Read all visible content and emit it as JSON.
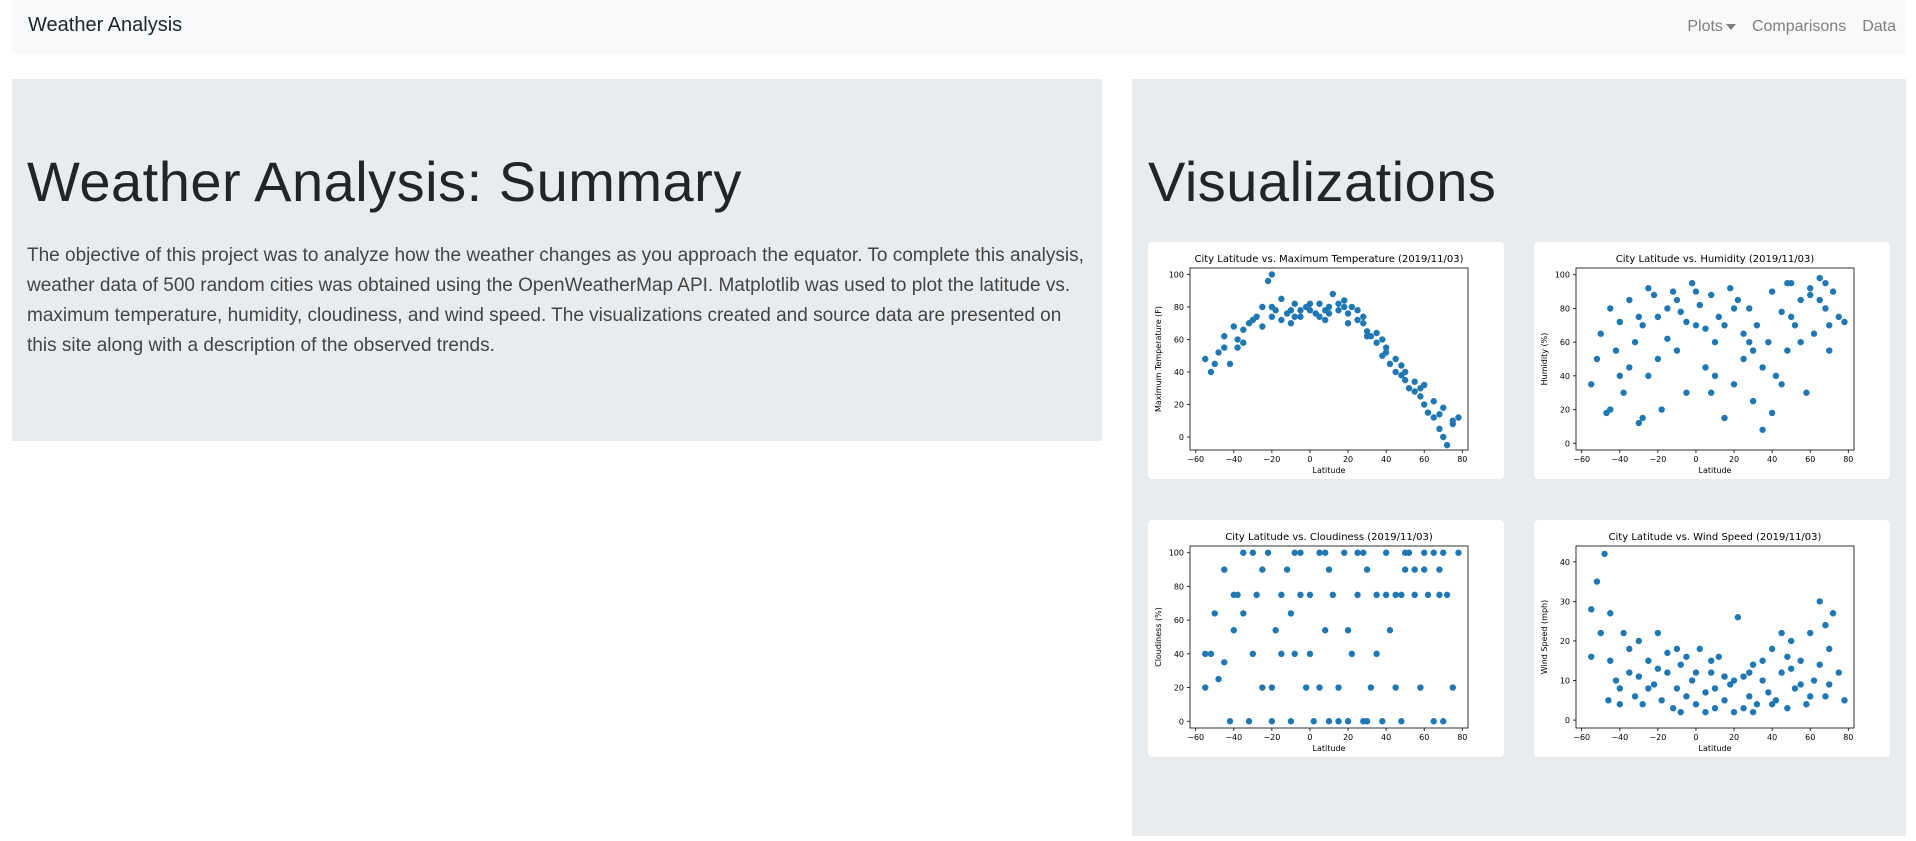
{
  "navbar": {
    "brand": "Weather Analysis",
    "links": [
      {
        "label": "Plots",
        "dropdown": true
      },
      {
        "label": "Comparisons"
      },
      {
        "label": "Data"
      }
    ]
  },
  "summary": {
    "title": "Weather Analysis: Summary",
    "body": "The objective of this project was to analyze how the weather changes as you approach the equator. To complete this analysis, weather data of 500 random cities was obtained using the OpenWeatherMap API. Matplotlib was used to plot the latitude vs. maximum temperature, humidity, cloudiness, and wind speed. The visualizations created and source data are presented on this site along with a description of the observed trends."
  },
  "visualizations": {
    "title": "Visualizations"
  },
  "colors": {
    "point": "#1f77b4"
  },
  "chart_data": [
    {
      "type": "scatter",
      "title": "City Latitude vs. Maximum Temperature (2019/11/03)",
      "xlabel": "Latitude",
      "ylabel": "Maximum Temperature (F)",
      "xlim": [
        -63,
        83
      ],
      "ylim": [
        -8,
        104
      ],
      "xticks": [
        -60,
        -40,
        -20,
        0,
        20,
        40,
        60,
        80
      ],
      "yticks": [
        0,
        20,
        40,
        60,
        80,
        100
      ],
      "points": [
        [
          -55,
          48
        ],
        [
          -52,
          40
        ],
        [
          -48,
          52
        ],
        [
          -45,
          55
        ],
        [
          -42,
          45
        ],
        [
          -38,
          60
        ],
        [
          -35,
          66
        ],
        [
          -32,
          70
        ],
        [
          -28,
          74
        ],
        [
          -25,
          80
        ],
        [
          -22,
          96
        ],
        [
          -20,
          100
        ],
        [
          -18,
          78
        ],
        [
          -15,
          85
        ],
        [
          -12,
          76
        ],
        [
          -10,
          70
        ],
        [
          -8,
          82
        ],
        [
          -5,
          74
        ],
        [
          -2,
          80
        ],
        [
          0,
          78
        ],
        [
          3,
          76
        ],
        [
          5,
          82
        ],
        [
          8,
          72
        ],
        [
          10,
          80
        ],
        [
          12,
          88
        ],
        [
          15,
          78
        ],
        [
          18,
          84
        ],
        [
          20,
          76
        ],
        [
          22,
          80
        ],
        [
          25,
          72
        ],
        [
          28,
          70
        ],
        [
          30,
          65
        ],
        [
          32,
          62
        ],
        [
          35,
          58
        ],
        [
          38,
          50
        ],
        [
          40,
          55
        ],
        [
          42,
          45
        ],
        [
          45,
          40
        ],
        [
          48,
          38
        ],
        [
          50,
          35
        ],
        [
          52,
          30
        ],
        [
          55,
          28
        ],
        [
          58,
          25
        ],
        [
          60,
          20
        ],
        [
          62,
          15
        ],
        [
          65,
          12
        ],
        [
          68,
          5
        ],
        [
          70,
          0
        ],
        [
          72,
          -5
        ],
        [
          75,
          10
        ],
        [
          -45,
          62
        ],
        [
          -40,
          68
        ],
        [
          -30,
          72
        ],
        [
          -20,
          74
        ],
        [
          -10,
          78
        ],
        [
          0,
          82
        ],
        [
          10,
          76
        ],
        [
          20,
          70
        ],
        [
          30,
          62
        ],
        [
          40,
          52
        ],
        [
          50,
          40
        ],
        [
          60,
          32
        ],
        [
          70,
          18
        ],
        [
          -38,
          55
        ],
        [
          -25,
          68
        ],
        [
          -15,
          72
        ],
        [
          -5,
          78
        ],
        [
          5,
          74
        ],
        [
          15,
          82
        ],
        [
          25,
          78
        ],
        [
          35,
          64
        ],
        [
          45,
          48
        ],
        [
          55,
          34
        ],
        [
          65,
          22
        ],
        [
          75,
          8
        ],
        [
          -50,
          45
        ],
        [
          -35,
          58
        ],
        [
          -20,
          80
        ],
        [
          -8,
          74
        ],
        [
          8,
          78
        ],
        [
          18,
          80
        ],
        [
          28,
          74
        ],
        [
          38,
          60
        ],
        [
          48,
          44
        ],
        [
          58,
          30
        ],
        [
          68,
          14
        ],
        [
          78,
          12
        ]
      ]
    },
    {
      "type": "scatter",
      "title": "City Latitude vs. Humidity (2019/11/03)",
      "xlabel": "Latitude",
      "ylabel": "Humidity (%)",
      "xlim": [
        -63,
        83
      ],
      "ylim": [
        -4,
        104
      ],
      "xticks": [
        -60,
        -40,
        -20,
        0,
        20,
        40,
        60,
        80
      ],
      "yticks": [
        0,
        20,
        40,
        60,
        80,
        100
      ],
      "points": [
        [
          -55,
          35
        ],
        [
          -50,
          65
        ],
        [
          -47,
          18
        ],
        [
          -45,
          80
        ],
        [
          -42,
          55
        ],
        [
          -40,
          72
        ],
        [
          -38,
          30
        ],
        [
          -35,
          85
        ],
        [
          -32,
          60
        ],
        [
          -30,
          12
        ],
        [
          -28,
          70
        ],
        [
          -25,
          40
        ],
        [
          -22,
          88
        ],
        [
          -20,
          75
        ],
        [
          -18,
          20
        ],
        [
          -15,
          62
        ],
        [
          -12,
          90
        ],
        [
          -10,
          55
        ],
        [
          -8,
          78
        ],
        [
          -5,
          30
        ],
        [
          -2,
          95
        ],
        [
          0,
          70
        ],
        [
          2,
          82
        ],
        [
          5,
          45
        ],
        [
          8,
          88
        ],
        [
          10,
          60
        ],
        [
          12,
          75
        ],
        [
          15,
          15
        ],
        [
          18,
          92
        ],
        [
          20,
          35
        ],
        [
          22,
          85
        ],
        [
          25,
          50
        ],
        [
          28,
          80
        ],
        [
          30,
          25
        ],
        [
          32,
          70
        ],
        [
          35,
          8
        ],
        [
          38,
          60
        ],
        [
          40,
          90
        ],
        [
          42,
          40
        ],
        [
          45,
          78
        ],
        [
          48,
          55
        ],
        [
          50,
          95
        ],
        [
          52,
          70
        ],
        [
          55,
          85
        ],
        [
          58,
          30
        ],
        [
          60,
          92
        ],
        [
          62,
          65
        ],
        [
          65,
          98
        ],
        [
          68,
          80
        ],
        [
          70,
          55
        ],
        [
          72,
          90
        ],
        [
          75,
          75
        ],
        [
          78,
          72
        ],
        [
          -45,
          20
        ],
        [
          -35,
          45
        ],
        [
          -25,
          92
        ],
        [
          -15,
          80
        ],
        [
          -5,
          72
        ],
        [
          5,
          68
        ],
        [
          15,
          70
        ],
        [
          25,
          65
        ],
        [
          35,
          45
        ],
        [
          45,
          35
        ],
        [
          55,
          60
        ],
        [
          65,
          85
        ],
        [
          -40,
          40
        ],
        [
          -30,
          75
        ],
        [
          -20,
          50
        ],
        [
          -10,
          85
        ],
        [
          0,
          90
        ],
        [
          10,
          40
        ],
        [
          20,
          80
        ],
        [
          30,
          55
        ],
        [
          40,
          18
        ],
        [
          50,
          75
        ],
        [
          60,
          88
        ],
        [
          70,
          70
        ],
        [
          -52,
          50
        ],
        [
          -28,
          15
        ],
        [
          8,
          30
        ],
        [
          28,
          60
        ],
        [
          48,
          95
        ],
        [
          68,
          95
        ]
      ]
    },
    {
      "type": "scatter",
      "title": "City Latitude vs. Cloudiness (2019/11/03)",
      "xlabel": "Latitude",
      "ylabel": "Cloudiness (%)",
      "xlim": [
        -63,
        83
      ],
      "ylim": [
        -4,
        104
      ],
      "xticks": [
        -60,
        -40,
        -20,
        0,
        20,
        40,
        60,
        80
      ],
      "yticks": [
        0,
        20,
        40,
        60,
        80,
        100
      ],
      "points": [
        [
          -55,
          20
        ],
        [
          -52,
          40
        ],
        [
          -50,
          64
        ],
        [
          -48,
          25
        ],
        [
          -45,
          90
        ],
        [
          -42,
          0
        ],
        [
          -40,
          54
        ],
        [
          -38,
          75
        ],
        [
          -35,
          100
        ],
        [
          -32,
          0
        ],
        [
          -30,
          40
        ],
        [
          -28,
          75
        ],
        [
          -25,
          20
        ],
        [
          -22,
          100
        ],
        [
          -20,
          0
        ],
        [
          -18,
          54
        ],
        [
          -15,
          75
        ],
        [
          -12,
          90
        ],
        [
          -10,
          0
        ],
        [
          -8,
          40
        ],
        [
          -5,
          100
        ],
        [
          -2,
          20
        ],
        [
          0,
          75
        ],
        [
          2,
          0
        ],
        [
          5,
          100
        ],
        [
          8,
          54
        ],
        [
          10,
          0
        ],
        [
          12,
          75
        ],
        [
          15,
          20
        ],
        [
          18,
          100
        ],
        [
          20,
          0
        ],
        [
          22,
          40
        ],
        [
          25,
          75
        ],
        [
          28,
          0
        ],
        [
          30,
          90
        ],
        [
          32,
          20
        ],
        [
          35,
          75
        ],
        [
          38,
          0
        ],
        [
          40,
          100
        ],
        [
          42,
          54
        ],
        [
          45,
          75
        ],
        [
          48,
          0
        ],
        [
          50,
          90
        ],
        [
          52,
          100
        ],
        [
          55,
          75
        ],
        [
          58,
          20
        ],
        [
          60,
          100
        ],
        [
          62,
          75
        ],
        [
          65,
          0
        ],
        [
          68,
          90
        ],
        [
          70,
          100
        ],
        [
          72,
          75
        ],
        [
          75,
          20
        ],
        [
          78,
          100
        ],
        [
          -45,
          35
        ],
        [
          -35,
          64
        ],
        [
          -25,
          90
        ],
        [
          -15,
          40
        ],
        [
          -5,
          75
        ],
        [
          5,
          20
        ],
        [
          15,
          0
        ],
        [
          25,
          100
        ],
        [
          35,
          40
        ],
        [
          45,
          20
        ],
        [
          55,
          90
        ],
        [
          65,
          100
        ],
        [
          -40,
          75
        ],
        [
          -30,
          100
        ],
        [
          -20,
          20
        ],
        [
          -10,
          64
        ],
        [
          0,
          40
        ],
        [
          10,
          90
        ],
        [
          20,
          54
        ],
        [
          30,
          0
        ],
        [
          40,
          75
        ],
        [
          50,
          100
        ],
        [
          60,
          90
        ],
        [
          70,
          0
        ],
        [
          -55,
          40
        ],
        [
          -8,
          100
        ],
        [
          8,
          100
        ],
        [
          28,
          100
        ],
        [
          48,
          75
        ],
        [
          68,
          75
        ]
      ]
    },
    {
      "type": "scatter",
      "title": "City Latitude vs. Wind Speed (2019/11/03)",
      "xlabel": "Latitude",
      "ylabel": "Wind Speed (mph)",
      "xlim": [
        -63,
        83
      ],
      "ylim": [
        -2,
        44
      ],
      "xticks": [
        -60,
        -40,
        -20,
        0,
        20,
        40,
        60,
        80
      ],
      "yticks": [
        0,
        10,
        20,
        30,
        40
      ],
      "points": [
        [
          -55,
          28
        ],
        [
          -52,
          35
        ],
        [
          -50,
          22
        ],
        [
          -48,
          42
        ],
        [
          -46,
          5
        ],
        [
          -45,
          27
        ],
        [
          -42,
          10
        ],
        [
          -40,
          8
        ],
        [
          -38,
          22
        ],
        [
          -35,
          12
        ],
        [
          -32,
          6
        ],
        [
          -30,
          20
        ],
        [
          -28,
          4
        ],
        [
          -25,
          15
        ],
        [
          -22,
          9
        ],
        [
          -20,
          22
        ],
        [
          -18,
          5
        ],
        [
          -15,
          12
        ],
        [
          -12,
          3
        ],
        [
          -10,
          8
        ],
        [
          -8,
          14
        ],
        [
          -5,
          6
        ],
        [
          -2,
          10
        ],
        [
          0,
          4
        ],
        [
          2,
          18
        ],
        [
          5,
          7
        ],
        [
          8,
          12
        ],
        [
          10,
          3
        ],
        [
          12,
          16
        ],
        [
          15,
          5
        ],
        [
          18,
          9
        ],
        [
          20,
          2
        ],
        [
          22,
          26
        ],
        [
          25,
          11
        ],
        [
          28,
          6
        ],
        [
          30,
          14
        ],
        [
          32,
          4
        ],
        [
          35,
          10
        ],
        [
          38,
          7
        ],
        [
          40,
          18
        ],
        [
          42,
          5
        ],
        [
          45,
          12
        ],
        [
          48,
          3
        ],
        [
          50,
          20
        ],
        [
          52,
          8
        ],
        [
          55,
          15
        ],
        [
          58,
          4
        ],
        [
          60,
          22
        ],
        [
          62,
          10
        ],
        [
          65,
          30
        ],
        [
          68,
          6
        ],
        [
          70,
          18
        ],
        [
          72,
          27
        ],
        [
          75,
          12
        ],
        [
          78,
          5
        ],
        [
          -45,
          15
        ],
        [
          -35,
          18
        ],
        [
          -25,
          8
        ],
        [
          -15,
          17
        ],
        [
          -5,
          16
        ],
        [
          5,
          2
        ],
        [
          15,
          11
        ],
        [
          25,
          3
        ],
        [
          35,
          15
        ],
        [
          45,
          22
        ],
        [
          55,
          9
        ],
        [
          65,
          14
        ],
        [
          -40,
          4
        ],
        [
          -30,
          11
        ],
        [
          -20,
          13
        ],
        [
          -10,
          18
        ],
        [
          0,
          12
        ],
        [
          10,
          8
        ],
        [
          20,
          10
        ],
        [
          30,
          2
        ],
        [
          40,
          4
        ],
        [
          50,
          13
        ],
        [
          60,
          6
        ],
        [
          70,
          9
        ],
        [
          -55,
          16
        ],
        [
          -8,
          2
        ],
        [
          8,
          15
        ],
        [
          28,
          12
        ],
        [
          48,
          16
        ],
        [
          68,
          24
        ]
      ]
    }
  ]
}
